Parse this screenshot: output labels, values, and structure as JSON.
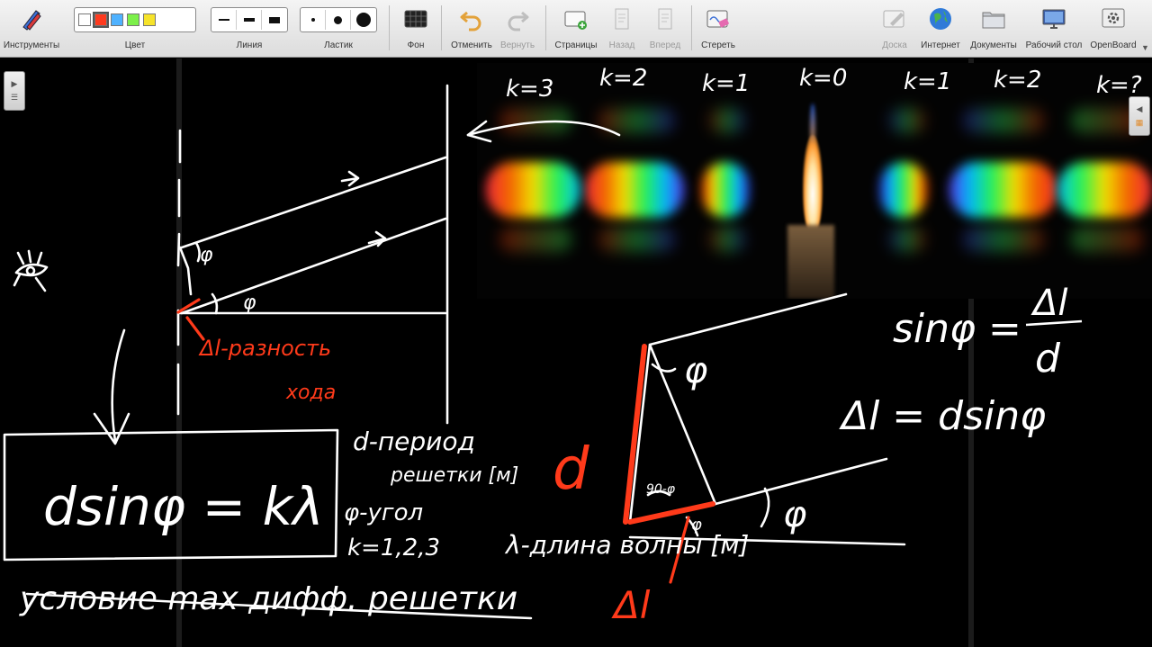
{
  "toolbar": {
    "tools_label": "Инструменты",
    "color_label": "Цвет",
    "line_label": "Линия",
    "eraser_label": "Ластик",
    "background_label": "Фон",
    "undo_label": "Отменить",
    "redo_label": "Вернуть",
    "pages_label": "Страницы",
    "back_label": "Назад",
    "forward_label": "Вперед",
    "erase_label": "Стереть",
    "board_label": "Доска",
    "internet_label": "Интернет",
    "documents_label": "Документы",
    "desktop_label": "Рабочий стол",
    "openboard_label": "OpenBoard"
  },
  "colors": {
    "palette": [
      "#ffffff",
      "#ff3b1f",
      "#4fb2ff",
      "#7cf04a",
      "#f6e32a"
    ],
    "selected": "#ff3b1f",
    "ink": "#ffffff",
    "accent_ink": "#ff3a1a"
  },
  "spectrum_labels": [
    "k=3",
    "k=2",
    "k=1",
    "k=0",
    "k=1",
    "k=2",
    "k=?"
  ],
  "handwriting": {
    "main_formula": "dsinφ = kλ",
    "condition": "условие max дифф. решетки",
    "d_def_1": "d-период",
    "d_def_2": "решетки [м]",
    "phi_def": "φ-угол",
    "k_def": "k=1,2,3",
    "lambda_def": "λ-длина волны [м]",
    "delta_l_def_1": "Δl-разность",
    "delta_l_def_2": "хода",
    "sin_formula_left": "sinφ =",
    "sin_num": "Δl",
    "sin_den": "d",
    "delta_formula": "Δl = dsinφ",
    "phi": "φ",
    "angle_90": "90-φ",
    "d_letter": "d",
    "delta_l": "Δl"
  }
}
